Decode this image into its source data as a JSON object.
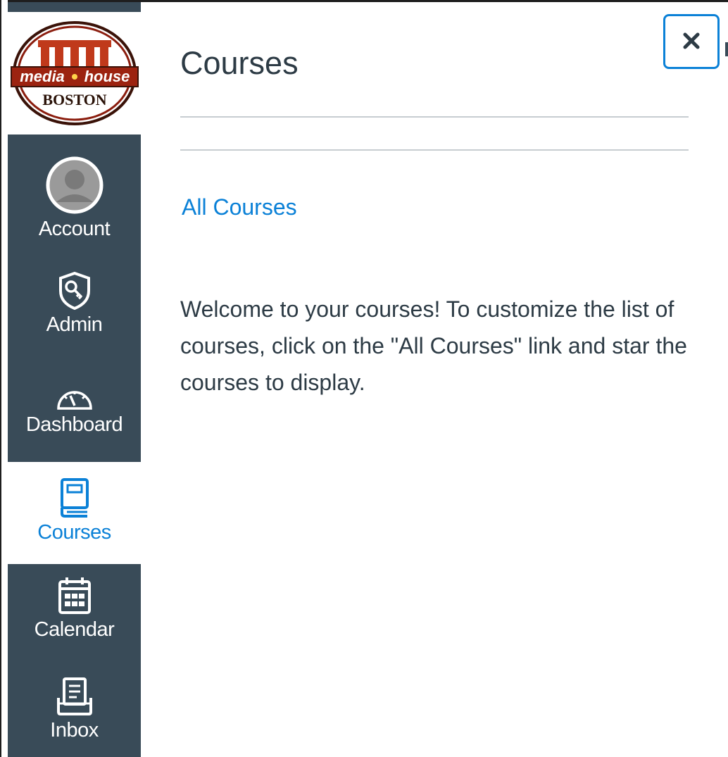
{
  "logo": {
    "line1": "media",
    "line2": "house",
    "line3": "BOSTON"
  },
  "nav": {
    "items": [
      {
        "label": "Account",
        "icon": "user-avatar-icon",
        "active": false
      },
      {
        "label": "Admin",
        "icon": "shield-key-icon",
        "active": false
      },
      {
        "label": "Dashboard",
        "icon": "speedometer-icon",
        "active": false
      },
      {
        "label": "Courses",
        "icon": "book-icon",
        "active": true
      },
      {
        "label": "Calendar",
        "icon": "calendar-icon",
        "active": false
      },
      {
        "label": "Inbox",
        "icon": "inbox-icon",
        "active": false
      }
    ]
  },
  "tray": {
    "title": "Courses",
    "all_courses_link": "All Courses",
    "welcome_text": "Welcome to your courses! To customize the list of courses, click on the \"All Courses\" link and star the courses to display.",
    "close_label": "×"
  },
  "colors": {
    "nav_bg": "#394b58",
    "accent": "#0b81d7",
    "text": "#2d3b45",
    "rule": "#c7cdd1"
  }
}
